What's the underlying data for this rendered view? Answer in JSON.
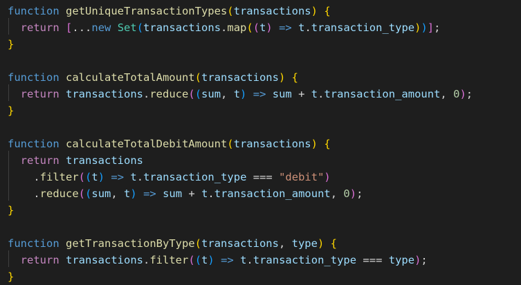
{
  "lines": [
    [
      [
        "kw",
        "function"
      ],
      [
        "op",
        " "
      ],
      [
        "fn",
        "getUniqueTransactionTypes"
      ],
      [
        "b1",
        "("
      ],
      [
        "var",
        "transactions"
      ],
      [
        "b1",
        ")"
      ],
      [
        "op",
        " "
      ],
      [
        "b1",
        "{"
      ]
    ],
    [
      [
        "op",
        "  "
      ],
      [
        "kwc",
        "return"
      ],
      [
        "op",
        " "
      ],
      [
        "b2",
        "["
      ],
      [
        "op",
        "..."
      ],
      [
        "kw",
        "new"
      ],
      [
        "op",
        " "
      ],
      [
        "cls",
        "Set"
      ],
      [
        "b3",
        "("
      ],
      [
        "var",
        "transactions"
      ],
      [
        "op",
        "."
      ],
      [
        "fn",
        "map"
      ],
      [
        "b1",
        "("
      ],
      [
        "b2",
        "("
      ],
      [
        "var",
        "t"
      ],
      [
        "b2",
        ")"
      ],
      [
        "op",
        " "
      ],
      [
        "kw",
        "=>"
      ],
      [
        "op",
        " "
      ],
      [
        "var",
        "t"
      ],
      [
        "op",
        "."
      ],
      [
        "var",
        "transaction_type"
      ],
      [
        "b1",
        ")"
      ],
      [
        "b3",
        ")"
      ],
      [
        "b2",
        "]"
      ],
      [
        "op",
        ";"
      ]
    ],
    [
      [
        "b1",
        "}"
      ]
    ],
    [],
    [
      [
        "kw",
        "function"
      ],
      [
        "op",
        " "
      ],
      [
        "fn",
        "calculateTotalAmount"
      ],
      [
        "b1",
        "("
      ],
      [
        "var",
        "transactions"
      ],
      [
        "b1",
        ")"
      ],
      [
        "op",
        " "
      ],
      [
        "b1",
        "{"
      ]
    ],
    [
      [
        "op",
        "  "
      ],
      [
        "kwc",
        "return"
      ],
      [
        "op",
        " "
      ],
      [
        "var",
        "transactions"
      ],
      [
        "op",
        "."
      ],
      [
        "fn",
        "reduce"
      ],
      [
        "b2",
        "("
      ],
      [
        "b3",
        "("
      ],
      [
        "var",
        "sum"
      ],
      [
        "op",
        ", "
      ],
      [
        "var",
        "t"
      ],
      [
        "b3",
        ")"
      ],
      [
        "op",
        " "
      ],
      [
        "kw",
        "=>"
      ],
      [
        "op",
        " "
      ],
      [
        "var",
        "sum"
      ],
      [
        "op",
        " + "
      ],
      [
        "var",
        "t"
      ],
      [
        "op",
        "."
      ],
      [
        "var",
        "transaction_amount"
      ],
      [
        "op",
        ", "
      ],
      [
        "num",
        "0"
      ],
      [
        "b2",
        ")"
      ],
      [
        "op",
        ";"
      ]
    ],
    [
      [
        "b1",
        "}"
      ]
    ],
    [],
    [
      [
        "kw",
        "function"
      ],
      [
        "op",
        " "
      ],
      [
        "fn",
        "calculateTotalDebitAmount"
      ],
      [
        "b1",
        "("
      ],
      [
        "var",
        "transactions"
      ],
      [
        "b1",
        ")"
      ],
      [
        "op",
        " "
      ],
      [
        "b1",
        "{"
      ]
    ],
    [
      [
        "op",
        "  "
      ],
      [
        "kwc",
        "return"
      ],
      [
        "op",
        " "
      ],
      [
        "var",
        "transactions"
      ]
    ],
    [
      [
        "op",
        "    ."
      ],
      [
        "fn",
        "filter"
      ],
      [
        "b2",
        "("
      ],
      [
        "b3",
        "("
      ],
      [
        "var",
        "t"
      ],
      [
        "b3",
        ")"
      ],
      [
        "op",
        " "
      ],
      [
        "kw",
        "=>"
      ],
      [
        "op",
        " "
      ],
      [
        "var",
        "t"
      ],
      [
        "op",
        "."
      ],
      [
        "var",
        "transaction_type"
      ],
      [
        "op",
        " === "
      ],
      [
        "str",
        "\"debit\""
      ],
      [
        "b2",
        ")"
      ]
    ],
    [
      [
        "op",
        "    ."
      ],
      [
        "fn",
        "reduce"
      ],
      [
        "b2",
        "("
      ],
      [
        "b3",
        "("
      ],
      [
        "var",
        "sum"
      ],
      [
        "op",
        ", "
      ],
      [
        "var",
        "t"
      ],
      [
        "b3",
        ")"
      ],
      [
        "op",
        " "
      ],
      [
        "kw",
        "=>"
      ],
      [
        "op",
        " "
      ],
      [
        "var",
        "sum"
      ],
      [
        "op",
        " + "
      ],
      [
        "var",
        "t"
      ],
      [
        "op",
        "."
      ],
      [
        "var",
        "transaction_amount"
      ],
      [
        "op",
        ", "
      ],
      [
        "num",
        "0"
      ],
      [
        "b2",
        ")"
      ],
      [
        "op",
        ";"
      ]
    ],
    [
      [
        "b1",
        "}"
      ]
    ],
    [],
    [
      [
        "kw",
        "function"
      ],
      [
        "op",
        " "
      ],
      [
        "fn",
        "getTransactionByType"
      ],
      [
        "b1",
        "("
      ],
      [
        "var",
        "transactions"
      ],
      [
        "op",
        ", "
      ],
      [
        "var",
        "type"
      ],
      [
        "b1",
        ")"
      ],
      [
        "op",
        " "
      ],
      [
        "b1",
        "{"
      ]
    ],
    [
      [
        "op",
        "  "
      ],
      [
        "kwc",
        "return"
      ],
      [
        "op",
        " "
      ],
      [
        "var",
        "transactions"
      ],
      [
        "op",
        "."
      ],
      [
        "fn",
        "filter"
      ],
      [
        "b2",
        "("
      ],
      [
        "b3",
        "("
      ],
      [
        "var",
        "t"
      ],
      [
        "b3",
        ")"
      ],
      [
        "op",
        " "
      ],
      [
        "kw",
        "=>"
      ],
      [
        "op",
        " "
      ],
      [
        "var",
        "t"
      ],
      [
        "op",
        "."
      ],
      [
        "var",
        "transaction_type"
      ],
      [
        "op",
        " === "
      ],
      [
        "var",
        "type"
      ],
      [
        "b2",
        ")"
      ],
      [
        "op",
        ";"
      ]
    ],
    [
      [
        "b1",
        "}"
      ]
    ]
  ],
  "colors": {
    "background": "#1e1e1e",
    "keyword": "#569cd6",
    "control_keyword": "#c586c0",
    "function": "#dcdcaa",
    "variable": "#9cdcfe",
    "class": "#4ec9b0",
    "number": "#b5cea8",
    "string": "#ce9178",
    "bracket_level_1": "#ffd700",
    "bracket_level_2": "#da70d6",
    "bracket_level_3": "#179fff"
  }
}
